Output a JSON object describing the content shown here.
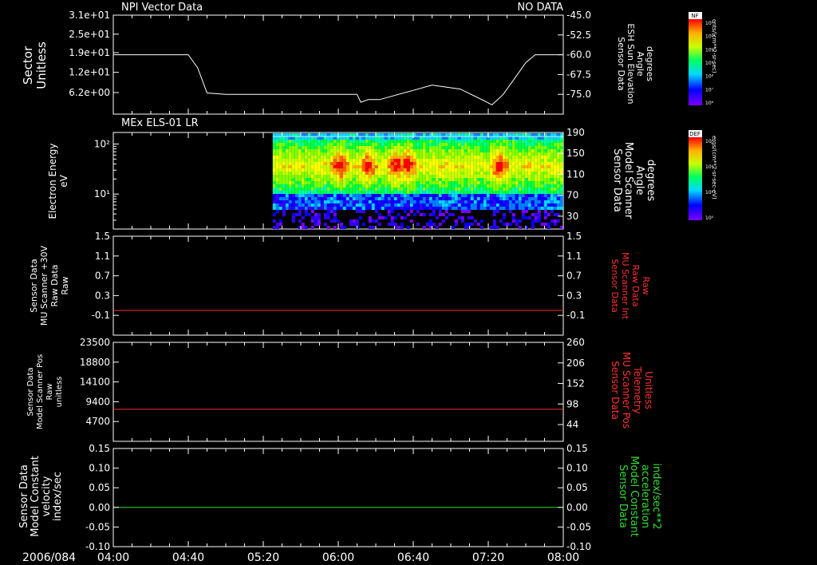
{
  "colors": {
    "background": "#000000",
    "foreground": "#ffffff",
    "red": "#ff3030",
    "green": "#33dd33"
  },
  "time_axis": {
    "date_label": "2006/084",
    "ticks": [
      "04:00",
      "04:40",
      "05:20",
      "06:00",
      "06:40",
      "07:20",
      "08:00"
    ]
  },
  "chart_data": [
    {
      "type": "line",
      "title": "NPI Vector Data",
      "status": "NO DATA",
      "ylabel": [
        "Sector",
        "Unitless"
      ],
      "y_ticks": [
        "3.1e+01",
        "2.5e+01",
        "1.9e+01",
        "1.2e+01",
        "6.2e+00"
      ],
      "ylabel_right": [
        "Sensor Data",
        "ESH Sun Elevation",
        "Angle",
        "degrees"
      ],
      "y_ticks_right": [
        "-45.0",
        "-52.5",
        "-60.0",
        "-67.5",
        "-75.0"
      ],
      "ylim_right": [
        -82.5,
        -45
      ],
      "series": [
        {
          "x": [
            "04:00",
            "04:20",
            "04:40",
            "04:45",
            "04:50",
            "05:00",
            "05:15",
            "05:40",
            "06:00",
            "06:10",
            "06:12",
            "06:16",
            "06:22",
            "06:40",
            "06:50",
            "07:05",
            "07:18",
            "07:22",
            "07:28",
            "07:35",
            "07:40",
            "07:45",
            "07:50",
            "08:00"
          ],
          "y": [
            -60,
            -60,
            -60,
            -65,
            -74.5,
            -75,
            -75,
            -75,
            -75,
            -75,
            -78,
            -77,
            -77,
            -73.5,
            -71.5,
            -73,
            -77.5,
            -79,
            -75,
            -68,
            -63,
            -60,
            -60,
            -60
          ]
        }
      ]
    },
    {
      "type": "heatmap",
      "title": "MEx ELS-01 LR",
      "ylabel": [
        "Electron Energy",
        "eV"
      ],
      "y_ticks": [
        "10²",
        "10¹"
      ],
      "ylim": [
        2,
        170
      ],
      "yscale": "log",
      "ylabel_right": [
        "Sensor Data",
        "Model Scanner",
        "Angle",
        "degrees"
      ],
      "y_ticks_right": [
        "190",
        "150",
        "110",
        "70",
        "30"
      ],
      "ylim_right": [
        10,
        190
      ],
      "data_start": "05:25",
      "bursts": [
        "06:00",
        "06:15",
        "06:30",
        "06:36",
        "07:25"
      ],
      "colorbar": {
        "label": "DEF",
        "units": "ergs/(cm**2-sr-sec-eV)",
        "ticks": [
          "10⁴",
          "10²",
          "10¹",
          "10⁰"
        ]
      }
    },
    {
      "type": "line",
      "ylabel": [
        "Sensor Data",
        "MU Scanner +30V",
        "Raw Data",
        "Raw"
      ],
      "y_ticks": [
        "1.5",
        "1.1",
        "0.7",
        "0.3",
        "-0.1"
      ],
      "ylim": [
        -0.5,
        1.5
      ],
      "ylabel_right": [
        "Sensor Data",
        "MU Scanner Int",
        "Raw Data",
        "Raw"
      ],
      "y_ticks_right": [
        "1.5",
        "1.1",
        "0.7",
        "0.3",
        "-0.1"
      ],
      "series": [
        {
          "color": "#ff3030",
          "x": [
            "04:00",
            "08:00"
          ],
          "y": [
            0,
            0
          ]
        }
      ]
    },
    {
      "type": "line",
      "ylabel": [
        "Sensor Data",
        "Model Scanner Pos",
        "Raw",
        "unitless"
      ],
      "y_ticks": [
        "23500",
        "18800",
        "14100",
        "9400",
        "4700"
      ],
      "ylim": [
        0,
        23500
      ],
      "ylabel_right": [
        "Sensor Data",
        "MU Scanner Pos",
        "Telemetry",
        "Unitless"
      ],
      "y_ticks_right": [
        "260",
        "206",
        "152",
        "98",
        "44"
      ],
      "ylim_right": [
        0,
        260
      ],
      "series": [
        {
          "color": "#ff3030",
          "x": [
            "04:00",
            "08:00"
          ],
          "y": [
            7600,
            7600
          ]
        }
      ]
    },
    {
      "type": "line",
      "ylabel": [
        "Sensor Data",
        "Model Constant",
        "velocity",
        "index/sec"
      ],
      "y_ticks": [
        "0.15",
        "0.10",
        "0.05",
        "0.00",
        "-0.05",
        "-0.10"
      ],
      "ylim": [
        -0.1,
        0.15
      ],
      "ylabel_right": [
        "Sensor Data",
        "Model Constant",
        "acceleration",
        "index/sec**2"
      ],
      "y_ticks_right": [
        "0.15",
        "0.10",
        "0.05",
        "0.00",
        "-0.05",
        "-0.10"
      ],
      "series": [
        {
          "color": "#33dd33",
          "x": [
            "04:00",
            "08:00"
          ],
          "y": [
            0,
            0
          ]
        }
      ]
    }
  ],
  "colorbar_top": {
    "label": "NF",
    "units": "cnts/(cm**2-sr-sec)",
    "ticks": [
      "10¹²",
      "10¹¹",
      "10¹⁰",
      "10⁹",
      "10⁸",
      "10⁷",
      "10⁶"
    ]
  }
}
